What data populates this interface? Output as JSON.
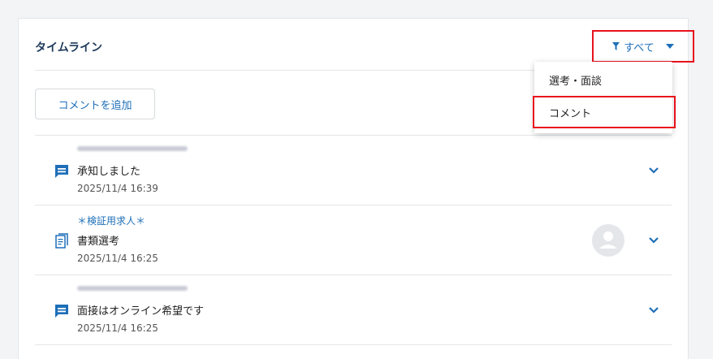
{
  "timeline": {
    "title": "タイムライン",
    "filter_label": "すべて",
    "add_comment_label": "コメントを追加",
    "colors": {
      "accent": "#1e6fb8",
      "highlight": "#e8121c"
    }
  },
  "filter_menu": {
    "options": [
      {
        "label": "選考・面談"
      },
      {
        "label": "コメント"
      }
    ]
  },
  "items": [
    {
      "type": "comment",
      "icon": "comment-icon",
      "text": "承知しました",
      "date": "2025/11/4 16:39"
    },
    {
      "type": "document",
      "icon": "document-review-icon",
      "job": "＊検証用求人＊",
      "text": "書類選考",
      "date": "2025/11/4 16:25"
    },
    {
      "type": "comment",
      "icon": "comment-icon",
      "text": "面接はオンライン希望です",
      "date": "2025/11/4 16:25"
    }
  ]
}
